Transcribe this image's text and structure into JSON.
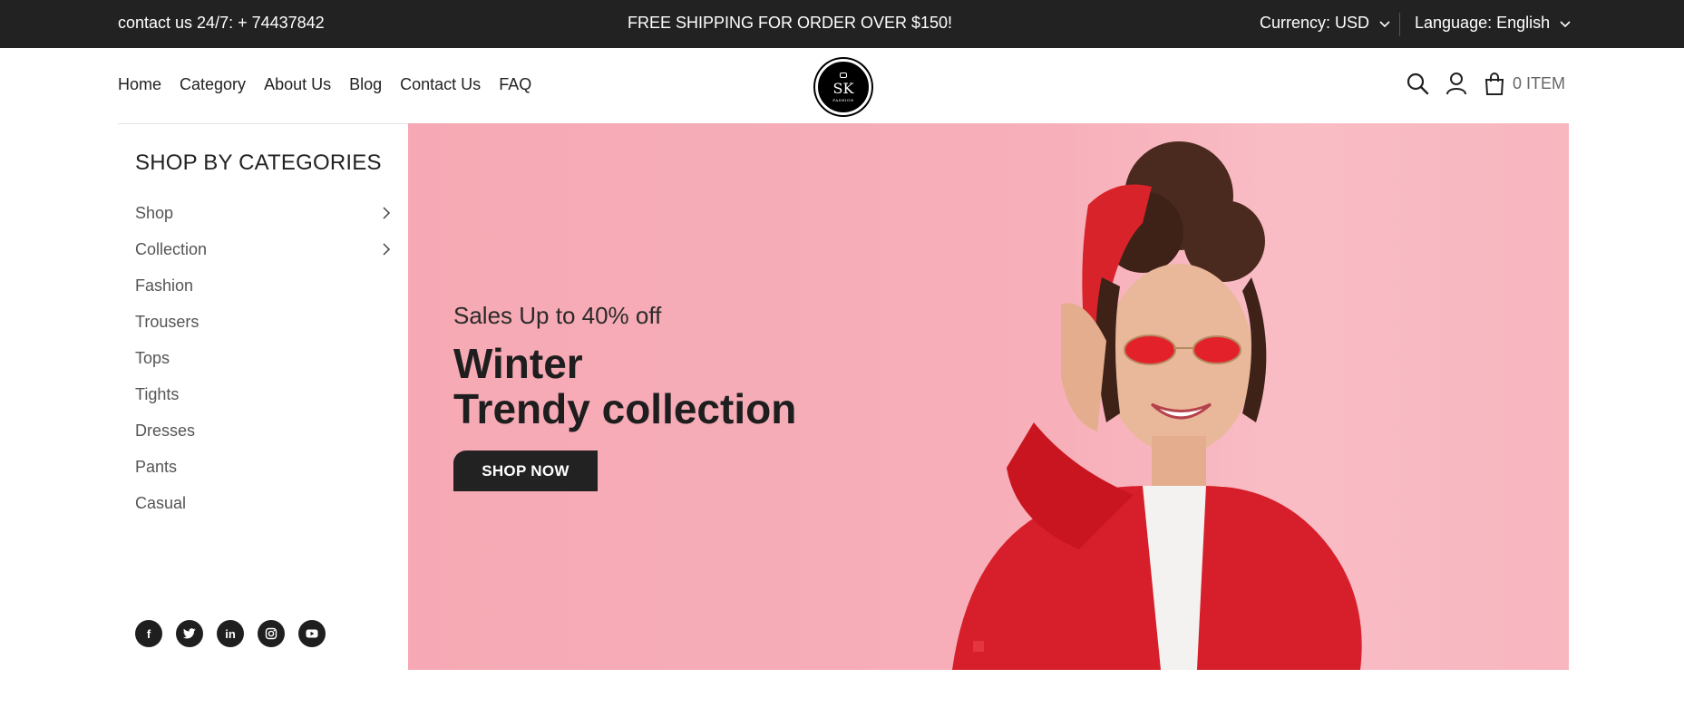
{
  "topbar": {
    "contact": "contact us 24/7: + 74437842",
    "shipping": "FREE SHIPPING FOR ORDER OVER $150!",
    "currency": "Currency: USD",
    "language": "Language: English"
  },
  "nav": {
    "items": [
      "Home",
      "Category",
      "About Us",
      "Blog",
      "Contact Us",
      "FAQ"
    ]
  },
  "logo": {
    "text": "SK",
    "subtext": "FASHION"
  },
  "header_icons": [
    "search-icon",
    "user-icon",
    "cart-icon"
  ],
  "cart": {
    "label": "0 ITEM"
  },
  "sidebar": {
    "title": "SHOP BY CATEGORIES",
    "categories": [
      {
        "label": "Shop",
        "has_submenu": true
      },
      {
        "label": "Collection",
        "has_submenu": true
      },
      {
        "label": "Fashion",
        "has_submenu": false
      },
      {
        "label": "Trousers",
        "has_submenu": false
      },
      {
        "label": "Tops",
        "has_submenu": false
      },
      {
        "label": "Tights",
        "has_submenu": false
      },
      {
        "label": "Dresses",
        "has_submenu": false
      },
      {
        "label": "Pants",
        "has_submenu": false
      },
      {
        "label": "Casual",
        "has_submenu": false
      }
    ],
    "social": [
      "facebook-icon",
      "twitter-icon",
      "linkedin-icon",
      "instagram-icon",
      "youtube-icon"
    ]
  },
  "hero": {
    "subtitle": "Sales Up to 40% off",
    "title_line1": "Winter",
    "title_line2": "Trendy collection",
    "button_label": "SHOP NOW",
    "background_color": "#f7afb9",
    "accent_color": "#e5363d"
  }
}
